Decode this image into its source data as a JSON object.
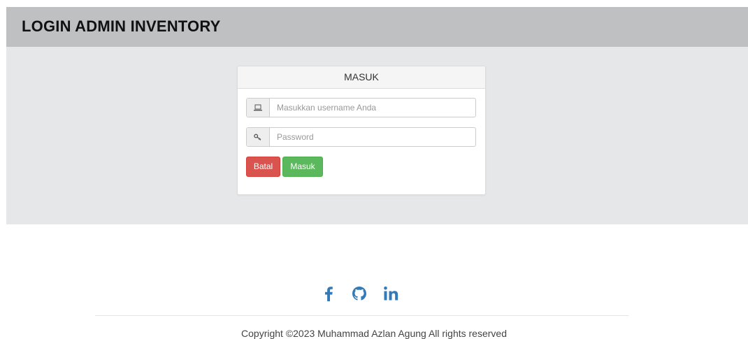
{
  "header": {
    "title": "LOGIN ADMIN INVENTORY"
  },
  "login_panel": {
    "heading": "MASUK",
    "username": {
      "icon": "laptop-icon",
      "value": "",
      "placeholder": "Masukkan username Anda"
    },
    "password": {
      "icon": "key-icon",
      "value": "",
      "placeholder": "Password"
    },
    "cancel_label": "Batal",
    "submit_label": "Masuk"
  },
  "footer": {
    "social_icons": [
      "facebook-icon",
      "github-icon",
      "linkedin-icon"
    ],
    "copyright": "Copyright ©2023 Muhammad Azlan Agung All rights reserved"
  },
  "colors": {
    "header_bg": "#bfc0c2",
    "jumbotron_bg": "#e6e7e8",
    "danger": "#d9534f",
    "success": "#5cb85c",
    "social_icon": "#337ab7"
  }
}
